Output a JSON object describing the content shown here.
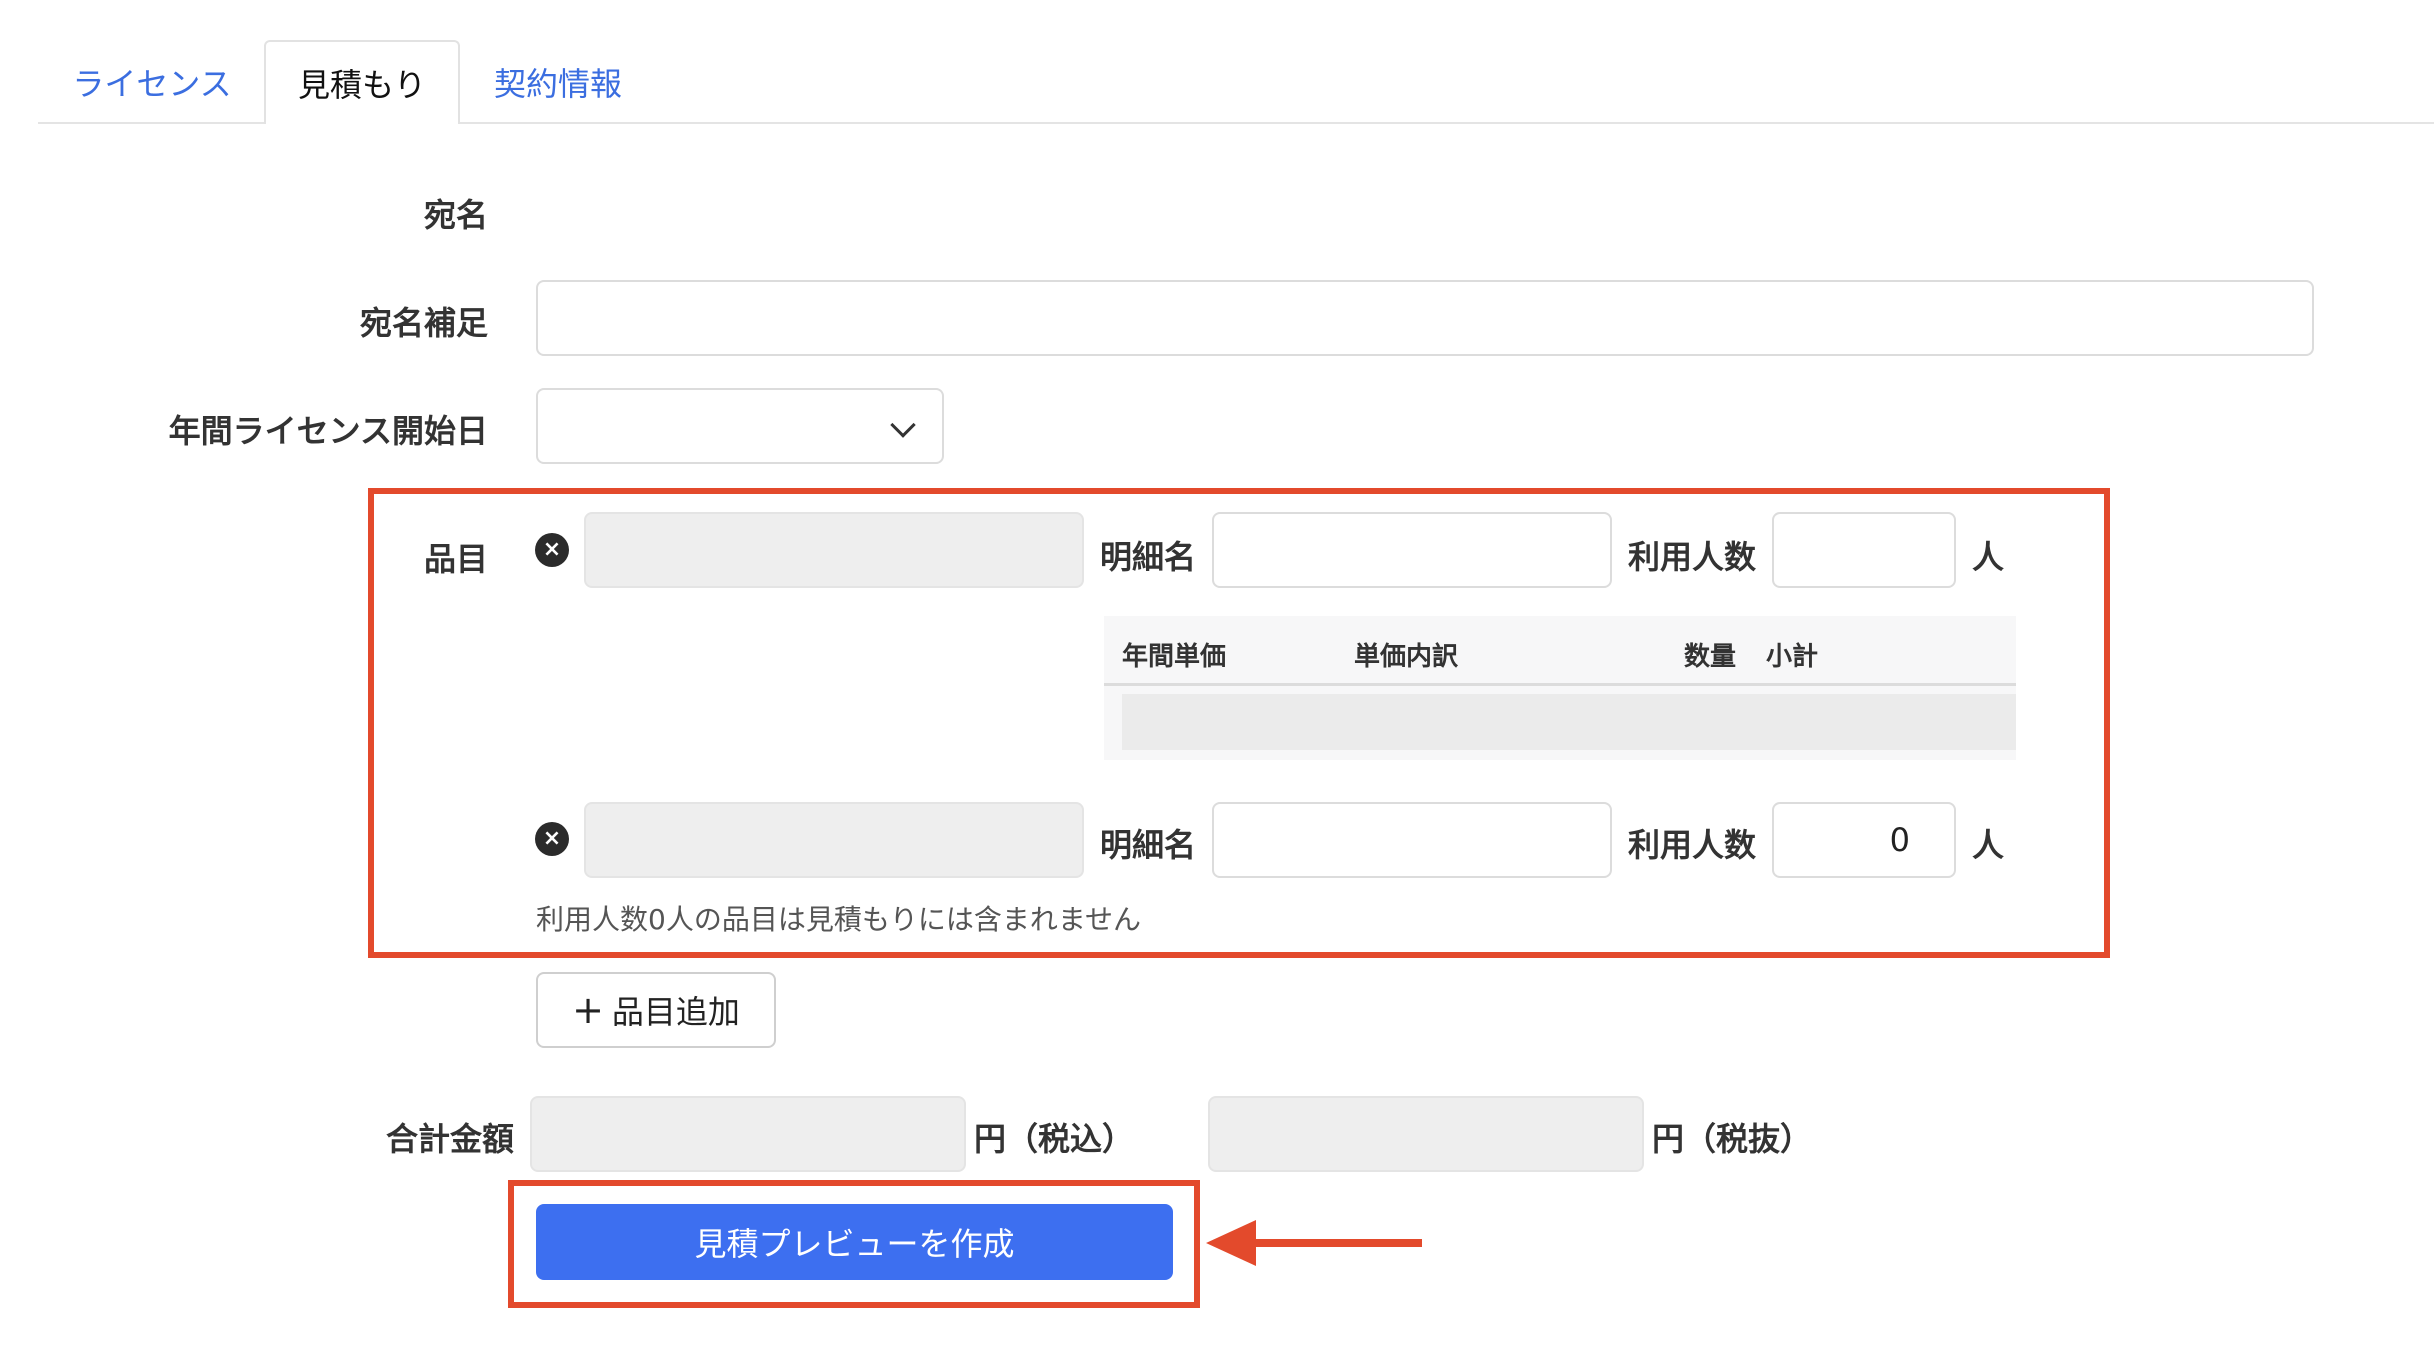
{
  "tabs": [
    {
      "label": "ライセンス",
      "active": false
    },
    {
      "label": "見積もり",
      "active": true
    },
    {
      "label": "契約情報",
      "active": false
    }
  ],
  "form": {
    "recipient_label": "宛名",
    "recipient_note_label": "宛名補足",
    "recipient_note_value": "",
    "start_date_label": "年間ライセンス開始日",
    "start_date_value": ""
  },
  "items": {
    "label": "品目",
    "detail_label": "明細名",
    "users_label": "利用人数",
    "users_unit": "人",
    "rows": [
      {
        "detail_value": "",
        "users_value": ""
      },
      {
        "detail_value": "",
        "users_value": "0"
      }
    ],
    "breakdown_headers": [
      "年間単価",
      "単価内訳",
      "数量",
      "小計"
    ],
    "note": "利用人数0人の品目は見積もりには含まれません"
  },
  "add_item_button": {
    "icon": "plus-icon",
    "label": "品目追加"
  },
  "totals": {
    "label": "合計金額",
    "tax_included_unit": "円（税込）",
    "tax_excluded_unit": "円（税抜）"
  },
  "preview_button": {
    "label": "見積プレビューを作成"
  },
  "colors": {
    "accent": "#3d6ff0",
    "link": "#3b6ee0",
    "highlight": "#e34a2c"
  }
}
